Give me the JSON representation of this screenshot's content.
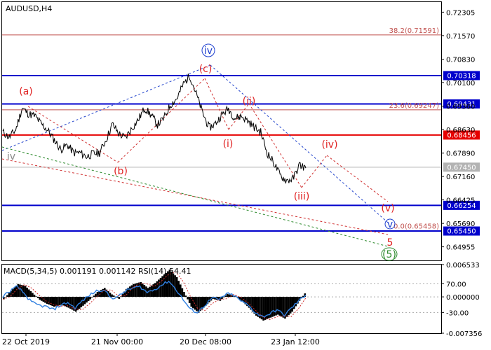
{
  "chart_data": [
    {
      "type": "line",
      "title": "AUDUSD,H4",
      "price_axis": {
        "ticks": [
          "0.72305",
          "0.71570",
          "0.70830",
          "0.70100",
          "0.69360",
          "0.68630",
          "0.67890",
          "0.67160",
          "0.66425",
          "0.65690",
          "0.64955"
        ],
        "ylim": [
          0.6453,
          0.7262
        ]
      },
      "x_ticks": [
        "22 Oct 2019",
        "21 Nov 00:00",
        "20 Dec 08:00",
        "23 Jan 12:00"
      ],
      "series": [
        {
          "name": "AUDUSD",
          "values": [
            0.6855,
            0.6838,
            0.6862,
            0.693,
            0.6912,
            0.6905,
            0.688,
            0.686,
            0.683,
            0.68,
            0.6815,
            0.679,
            0.679,
            0.6778,
            0.6787,
            0.679,
            0.683,
            0.688,
            0.685,
            0.6836,
            0.6866,
            0.6893,
            0.693,
            0.6908,
            0.6878,
            0.6898,
            0.694,
            0.696,
            0.7005,
            0.7032,
            0.6975,
            0.6915,
            0.6868,
            0.6882,
            0.691,
            0.6928,
            0.6898,
            0.6905,
            0.689,
            0.687,
            0.6855,
            0.679,
            0.676,
            0.672,
            0.6703,
            0.6708,
            0.6752,
            0.6742
          ]
        }
      ],
      "levels": [
        {
          "label": "38.2(0.71591)",
          "value": 0.71591,
          "color": "#c0504d"
        },
        {
          "label": "0.70318",
          "value": 0.70318,
          "color": "#0000cc"
        },
        {
          "label": "23.6(0.69247)",
          "value": 0.69247,
          "color": "#c0504d"
        },
        {
          "label": "0.69431",
          "value": 0.69431,
          "color": "#0000cc"
        },
        {
          "label": "0.68456",
          "value": 0.68456,
          "color": "#e60000"
        },
        {
          "label": "0.67450",
          "value": 0.6745,
          "color": "#b3b3b3"
        },
        {
          "label": "0.66254",
          "value": 0.66254,
          "color": "#0000cc"
        },
        {
          "label": "0.0(0.65458)",
          "value": 0.65458,
          "color": "#c0504d"
        },
        {
          "label": "0.65450",
          "value": 0.6545,
          "color": "#0000cc"
        }
      ],
      "wave_labels": [
        {
          "text": "(a)",
          "color": "#e02020"
        },
        {
          "text": "iv",
          "color": "#888888"
        },
        {
          "text": "(b)",
          "color": "#e02020"
        },
        {
          "text": "(c)",
          "color": "#e02020"
        },
        {
          "text": "iv",
          "color": "#1d3fcf"
        },
        {
          "text": "(i)",
          "color": "#e02020"
        },
        {
          "text": "(ii)",
          "color": "#e02020"
        },
        {
          "text": "(iii)",
          "color": "#e02020"
        },
        {
          "text": "(iv)",
          "color": "#e02020"
        },
        {
          "text": "(v)",
          "color": "#e02020"
        },
        {
          "text": "v",
          "color": "#1d3fcf"
        },
        {
          "text": "5",
          "color": "#e02020"
        },
        {
          "text": "(5)",
          "color": "#2e8b2e"
        }
      ]
    },
    {
      "type": "line",
      "title": "MACD(5,34,5) 0.001191 0.001142 RSI(14) 54.41",
      "price_axis": {
        "ticks": [
          "0.006533",
          "70.00",
          "0.000000",
          "-30.00",
          "-0.007356"
        ],
        "ylim": [
          -0.007356,
          0.006533
        ]
      },
      "series": [
        {
          "name": "MACD",
          "values": [
            -0.0005,
            0.0012,
            0.0026,
            0.0022,
            0.0008,
            -0.0006,
            -0.0014,
            -0.002,
            -0.0016,
            -0.0022,
            -0.003,
            -0.0018,
            -0.0005,
            0.001,
            0.0018,
            0.0005,
            -0.0004,
            0.0016,
            0.0026,
            0.003,
            0.0018,
            0.0028,
            0.0042,
            0.0055,
            0.004,
            0.001,
            -0.002,
            -0.0032,
            -0.0018,
            -0.0004,
            -0.0008,
            0.0006,
            0.0002,
            -0.0008,
            -0.0022,
            -0.0038,
            -0.0048,
            -0.0042,
            -0.0036,
            -0.0044,
            -0.003,
            -0.0008,
            0.0012
          ]
        },
        {
          "name": "RSI(14)",
          "values": [
            52,
            60,
            66,
            56,
            44,
            40,
            38,
            34,
            40,
            44,
            36,
            46,
            54,
            60,
            62,
            50,
            52,
            60,
            64,
            66,
            58,
            62,
            68,
            74,
            62,
            48,
            34,
            30,
            40,
            50,
            48,
            56,
            54,
            46,
            40,
            30,
            24,
            28,
            34,
            26,
            36,
            46,
            54.41
          ]
        }
      ]
    }
  ]
}
